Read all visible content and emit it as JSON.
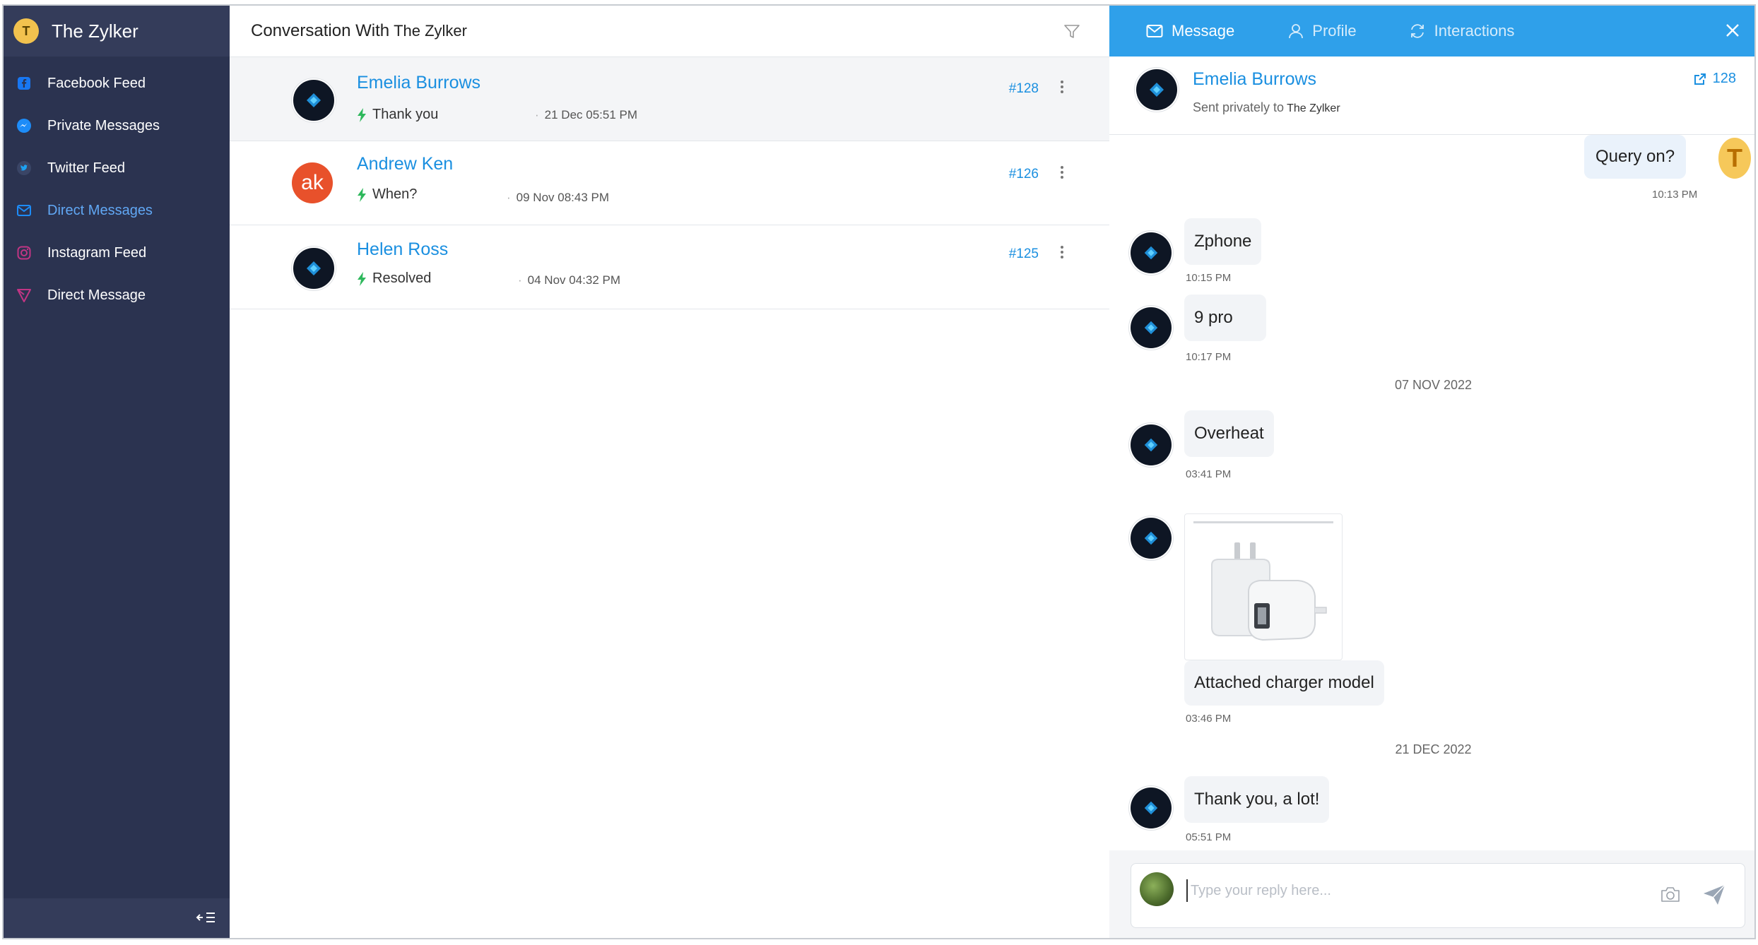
{
  "brand": {
    "initial": "T",
    "name": "The Zylker"
  },
  "sidebar": {
    "items": [
      {
        "label": "Facebook Feed",
        "icon": "facebook-icon",
        "active": false
      },
      {
        "label": "Private Messages",
        "icon": "messenger-icon",
        "active": false
      },
      {
        "label": "Twitter Feed",
        "icon": "twitter-icon",
        "active": false
      },
      {
        "label": "Direct Messages",
        "icon": "mail-icon",
        "active": true
      },
      {
        "label": "Instagram Feed",
        "icon": "instagram-icon",
        "active": false
      },
      {
        "label": "Direct Message",
        "icon": "instagram-direct-icon",
        "active": false
      }
    ],
    "collapse_icon": "collapse-sidebar-icon"
  },
  "middle": {
    "title_prefix": "Conversation With",
    "title_name": "The Zylker",
    "conversations": [
      {
        "name": "Emelia Burrows",
        "last_message": "Thank you",
        "time": "21 Dec 05:51 PM",
        "ticket": "#128",
        "avatar": "logo",
        "selected": true
      },
      {
        "name": "Andrew Ken",
        "last_message": "When?",
        "time": "09 Nov 08:43 PM",
        "ticket": "#126",
        "avatar": "ak",
        "selected": false
      },
      {
        "name": "Helen Ross",
        "last_message": "Resolved",
        "time": "04 Nov 04:32 PM",
        "ticket": "#125",
        "avatar": "logo",
        "selected": false
      }
    ]
  },
  "right": {
    "tabs": [
      {
        "label": "Message",
        "icon": "envelope-icon",
        "active": true
      },
      {
        "label": "Profile",
        "icon": "person-icon",
        "active": false
      },
      {
        "label": "Interactions",
        "icon": "sync-icon",
        "active": false
      }
    ],
    "contact": {
      "name": "Emelia Burrows",
      "sent_prefix": "Sent privately to",
      "sent_to": "The Zylker",
      "ticket": "128"
    },
    "messages": {
      "m1": {
        "text": "Query on?",
        "time": "10:13 PM",
        "avatar_initial": "T"
      },
      "m2": {
        "text": "Zphone",
        "time": "10:15 PM"
      },
      "m3": {
        "text": "9 pro",
        "time": "10:17 PM"
      },
      "date1": "07 NOV 2022",
      "m4": {
        "text": "Overheat",
        "time": "03:41 PM"
      },
      "m5": {
        "text": "Attached charger model",
        "time": "03:46 PM",
        "attachment": "charger-image"
      },
      "date2": "21 DEC 2022",
      "m6": {
        "text": "Thank you, a lot!",
        "time": "05:51 PM"
      }
    },
    "reply": {
      "placeholder": "Type your reply here..."
    }
  },
  "colors": {
    "sidebar": "#2b3350",
    "accent": "#2fa0ea",
    "link": "#1a8fe0",
    "active_nav": "#61a8f5"
  }
}
